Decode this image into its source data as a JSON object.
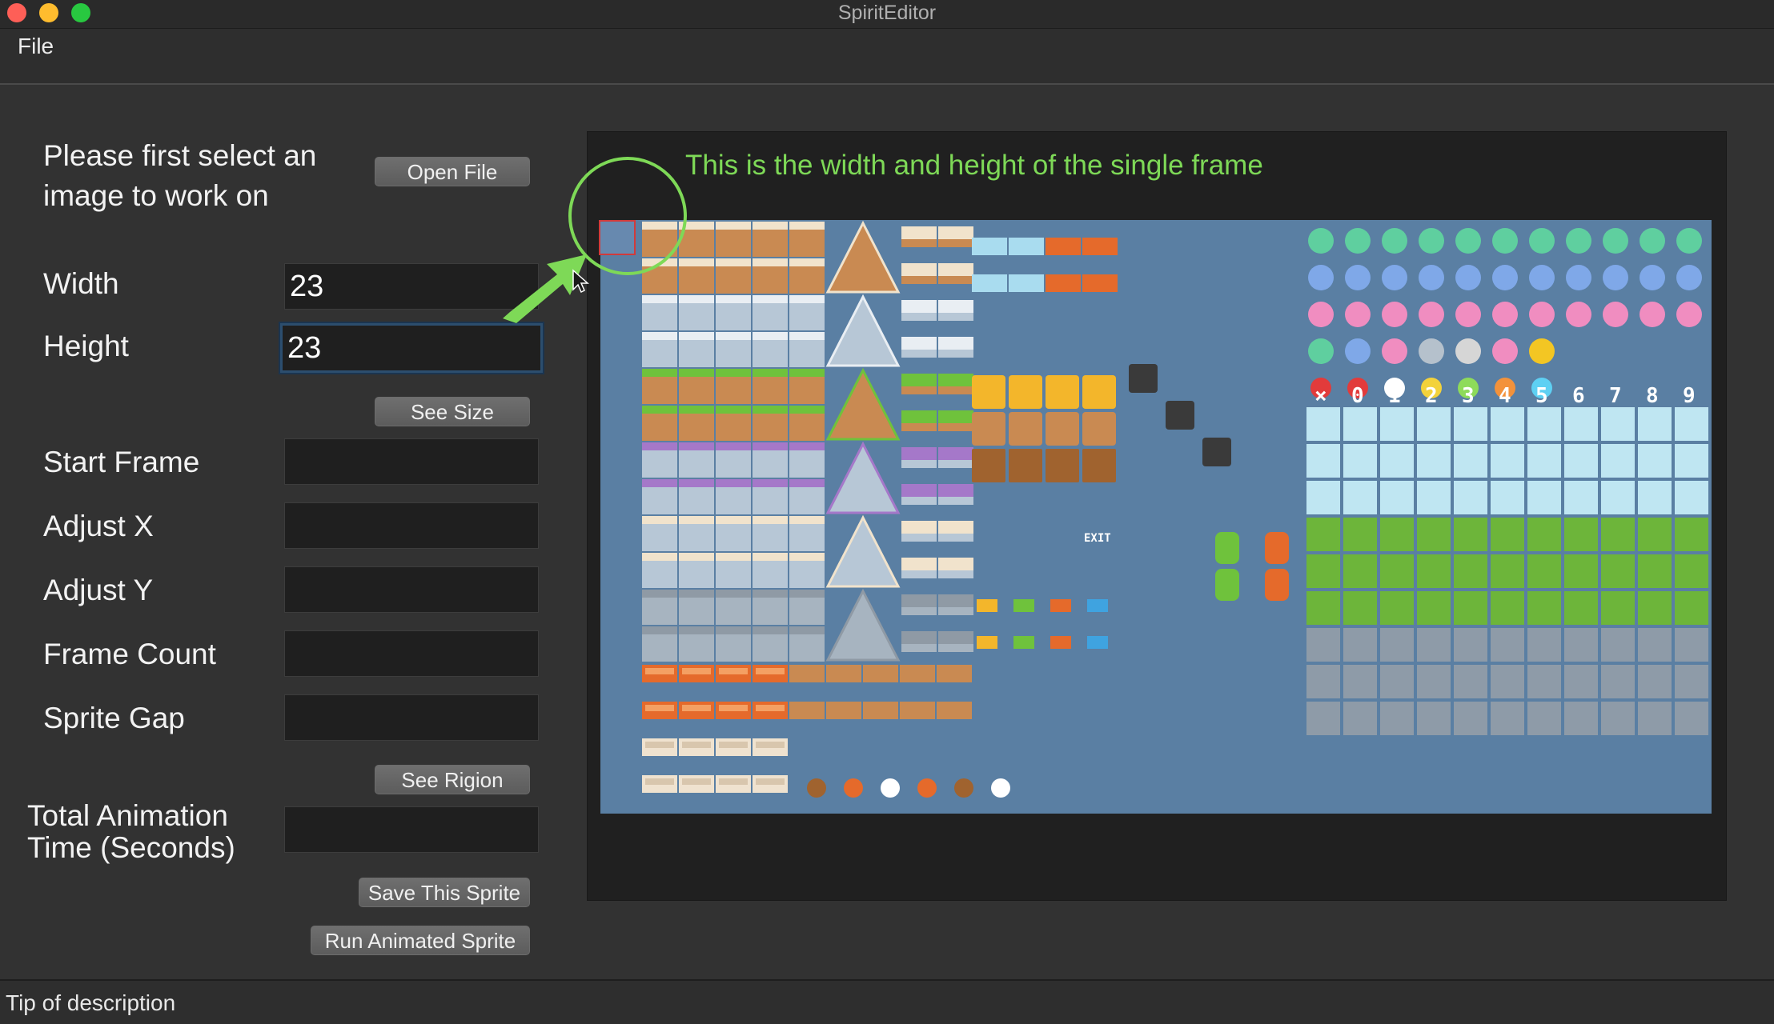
{
  "window": {
    "title": "SpiritEditor"
  },
  "menu": {
    "file": "File"
  },
  "left_panel": {
    "intro_text_line1": "Please first select an",
    "intro_text_line2": "image to work on",
    "open_file_button": "Open File",
    "width_label": "Width",
    "width_value": "23",
    "height_label": "Height",
    "height_value": "23",
    "see_size_button": "See Size",
    "start_frame_label": "Start Frame",
    "start_frame_value": "",
    "adjust_x_label": "Adjust X",
    "adjust_x_value": "",
    "adjust_y_label": "Adjust Y",
    "adjust_y_value": "",
    "frame_count_label": "Frame Count",
    "frame_count_value": "",
    "sprite_gap_label": "Sprite Gap",
    "sprite_gap_value": "",
    "see_region_button": "See Rigion",
    "total_time_label_line1": "Total Animation",
    "total_time_label_line2": "Time (Seconds)",
    "total_time_value": "",
    "save_sprite_button": "Save This Sprite",
    "run_animated_button": "Run Animated Sprite"
  },
  "canvas": {
    "annotation_text": "This is the width and height of the single frame",
    "sheet_digits": [
      "×",
      "0",
      "1",
      "2",
      "3",
      "4",
      "5",
      "6",
      "7",
      "8",
      "9"
    ],
    "exit_sign": "EXIT",
    "colors": {
      "sheet_background": "#5a7fa3",
      "annotation": "#7ed957",
      "frame_highlight": "#d23a3a"
    }
  },
  "status_bar": {
    "tip": "Tip of description"
  }
}
